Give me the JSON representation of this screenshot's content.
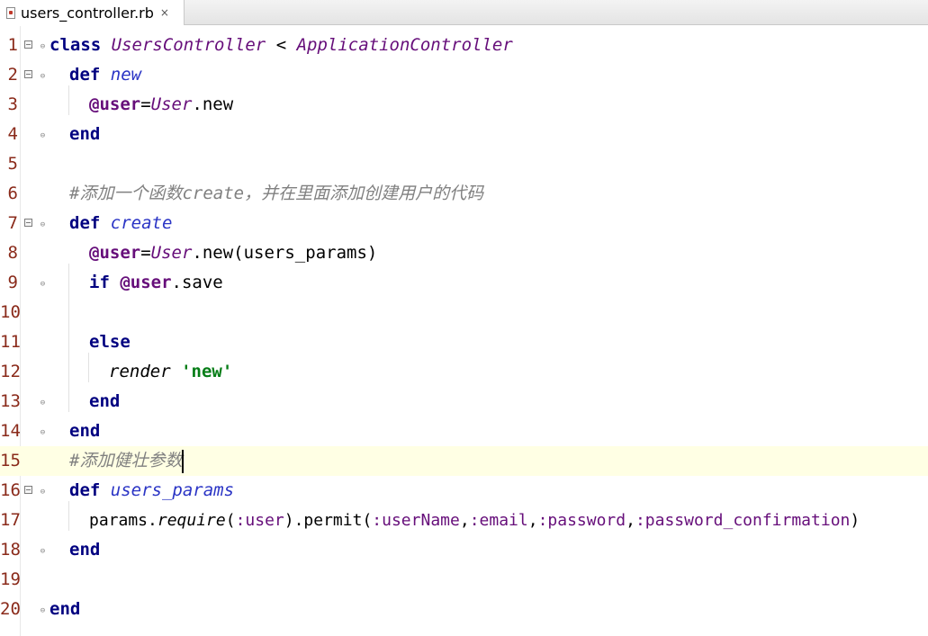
{
  "tab": {
    "filename": "users_controller.rb",
    "close_glyph": "×"
  },
  "line_numbers": [
    "1",
    "2",
    "3",
    "4",
    "5",
    "6",
    "7",
    "8",
    "9",
    "10",
    "11",
    "12",
    "13",
    "14",
    "15",
    "16",
    "17",
    "18",
    "19",
    "20"
  ],
  "tokens": {
    "l1_class": "class",
    "l1_name": "UsersController",
    "l1_lt": " < ",
    "l1_parent": "ApplicationController",
    "l2_def": "def",
    "l2_name": "new",
    "l3_ivar": "@user",
    "l3_eq": "=",
    "l3_const": "User",
    "l3_rest": ".new",
    "l4_end": "end",
    "l6_comment": "#添加一个函数create，并在里面添加创建用户的代码",
    "l7_def": "def",
    "l7_name": "create",
    "l8_ivar": "@user",
    "l8_eq": "=",
    "l8_const": "User",
    "l8_rest": ".new(users_params)",
    "l9_if": "if",
    "l9_ivar": "@user",
    "l9_rest": ".save",
    "l11_else": "else",
    "l12_render": "render",
    "l12_q": "'",
    "l12_str": "new'",
    "l13_end": "end",
    "l14_end": "end",
    "l15_comment": "#添加健壮参数",
    "l16_def": "def",
    "l16_name": "users_params",
    "l17_a": "params.",
    "l17_require": "require",
    "l17_b": "(",
    "l17_user": ":user",
    "l17_c": ").permit(",
    "l17_s1": ":userName",
    "l17_s2": ":email",
    "l17_s3": ":password",
    "l17_s4": ":password_confirmation",
    "l17_comma": ",",
    "l17_close": ")",
    "l18_end": "end",
    "l20_end": "end"
  },
  "colors": {
    "keyword": "#000080",
    "class_name": "#660e7a",
    "method_name": "#2a34c5",
    "comment": "#808080",
    "string": "#067d17",
    "line_number": "#8a2a1a",
    "current_line": "#ffffe4"
  },
  "icons": {
    "file": "ruby-file-icon",
    "bookmark": "method-marker-icon",
    "fold": "fold-icon"
  }
}
